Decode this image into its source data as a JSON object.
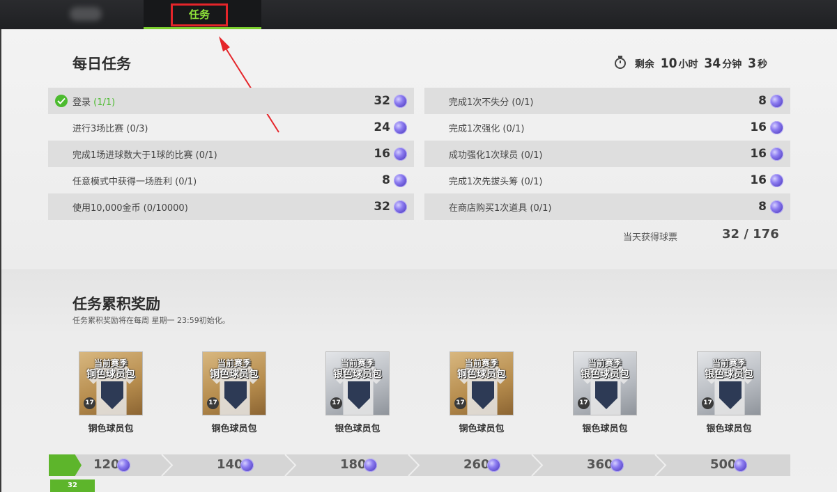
{
  "top_nav": {
    "active_tab": "任务"
  },
  "daily": {
    "title": "每日任务",
    "timer": {
      "prefix": "剩余",
      "hours": "10",
      "hours_unit": "小时",
      "minutes": "34",
      "minutes_unit": "分钟",
      "seconds": "3",
      "seconds_unit": "秒"
    },
    "left_tasks": [
      {
        "label": "登录 ",
        "progress": "(1/1)",
        "reward": "32",
        "done": true
      },
      {
        "label": "进行3场比赛 (0/3)",
        "progress": "",
        "reward": "24",
        "done": false
      },
      {
        "label": "完成1场进球数大于1球的比赛 (0/1)",
        "progress": "",
        "reward": "16",
        "done": false
      },
      {
        "label": "任意模式中获得一场胜利 (0/1)",
        "progress": "",
        "reward": "8",
        "done": false
      },
      {
        "label": "使用10,000金币 (0/10000)",
        "progress": "",
        "reward": "32",
        "done": false
      }
    ],
    "right_tasks": [
      {
        "label": "完成1次不失分 (0/1)",
        "reward": "8"
      },
      {
        "label": "完成1次强化 (0/1)",
        "reward": "16"
      },
      {
        "label": "成功强化1次球员 (0/1)",
        "reward": "16"
      },
      {
        "label": "完成1次先拔头筹 (0/1)",
        "reward": "16"
      },
      {
        "label": "在商店购买1次道具 (0/1)",
        "reward": "8"
      }
    ],
    "day_total_label": "当天获得球票",
    "day_total_value": "32 / 176"
  },
  "cumulative": {
    "title": "任务累积奖励",
    "note": "任务累积奖励将在每周 星期一 23:59初始化。",
    "packs": [
      {
        "card_line1": "当前赛季",
        "card_line2": "铜色球员包",
        "name": "铜色球员包",
        "tier": "bronze",
        "season": "17"
      },
      {
        "card_line1": "当前赛季",
        "card_line2": "铜色球员包",
        "name": "铜色球员包",
        "tier": "bronze",
        "season": "17"
      },
      {
        "card_line1": "当前赛季",
        "card_line2": "银色球员包",
        "name": "银色球员包",
        "tier": "silver",
        "season": "17"
      },
      {
        "card_line1": "当前赛季",
        "card_line2": "铜色球员包",
        "name": "铜色球员包",
        "tier": "bronze",
        "season": "17"
      },
      {
        "card_line1": "当前赛季",
        "card_line2": "银色球员包",
        "name": "银色球员包",
        "tier": "silver",
        "season": "17"
      },
      {
        "card_line1": "当前赛季",
        "card_line2": "银色球员包",
        "name": "银色球员包",
        "tier": "silver",
        "season": "17"
      }
    ],
    "milestones": [
      "120",
      "140",
      "180",
      "260",
      "360",
      "500"
    ],
    "current_progress": "32"
  },
  "colors": {
    "accent_green": "#5db52b",
    "highlight_red": "#e5252a",
    "coin_purple": "#7a68e0"
  }
}
